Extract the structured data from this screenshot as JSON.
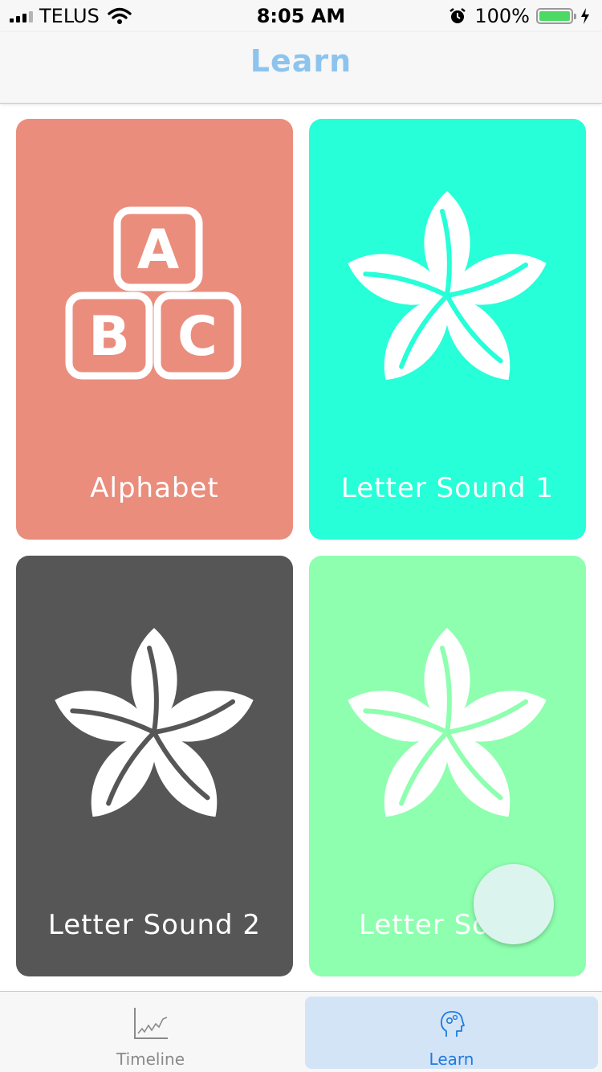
{
  "status_bar": {
    "carrier": "TELUS",
    "time": "8:05 AM",
    "battery_percent": "100%"
  },
  "nav": {
    "title": "Learn"
  },
  "cards": [
    {
      "label": "Alphabet",
      "color": "#ea8d7d",
      "icon": "abc-blocks-icon"
    },
    {
      "label": "Letter Sound 1",
      "color": "#26ffd8",
      "icon": "flower-icon"
    },
    {
      "label": "Letter Sound 2",
      "color": "#565656",
      "icon": "flower-icon"
    },
    {
      "label": "Letter Sou",
      "color": "#8dffae",
      "icon": "flower-icon"
    }
  ],
  "tabs": [
    {
      "label": "Timeline",
      "icon": "line-chart-icon",
      "active": false
    },
    {
      "label": "Learn",
      "icon": "head-gears-icon",
      "active": true
    }
  ]
}
